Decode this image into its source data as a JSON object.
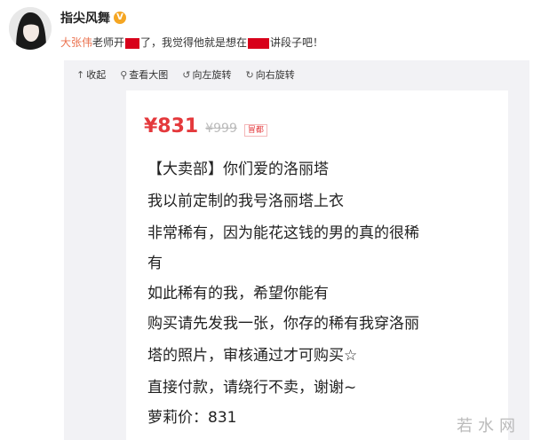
{
  "post": {
    "username": "指尖风舞",
    "verified_badge": "V",
    "mention": "大张伟",
    "text_a": "老师开",
    "text_b": "了，我觉得他就是想在",
    "text_c": "讲段子吧！"
  },
  "toolbar": {
    "collapse": "收起",
    "view_large": "查看大图",
    "rotate_left": "向左旋转",
    "rotate_right": "向右旋转"
  },
  "listing": {
    "price_current": "¥831",
    "price_original": "¥999",
    "price_tag": "冒都",
    "lines": [
      "【大卖部】你们爱的洛丽塔",
      "我以前定制的我号洛丽塔上衣",
      "非常稀有，因为能花这钱的男的真的很稀",
      "有",
      "如此稀有的我，希望你能有",
      "购买请先发我一张，你存的稀有我穿洛丽",
      "塔的照片，审核通过才可购买☆",
      "直接付款，请绕行不卖，谢谢~",
      "萝莉价：831"
    ]
  },
  "watermark": "若水网",
  "colors": {
    "mention": "#eb7350",
    "price": "#e4393c",
    "redaction": "#d8001a"
  },
  "icons": {
    "verified": "verified-v-icon",
    "collapse": "up-arrow-icon",
    "view_large": "magnifier-icon",
    "rotate_left": "rotate-left-icon",
    "rotate_right": "rotate-right-icon"
  }
}
